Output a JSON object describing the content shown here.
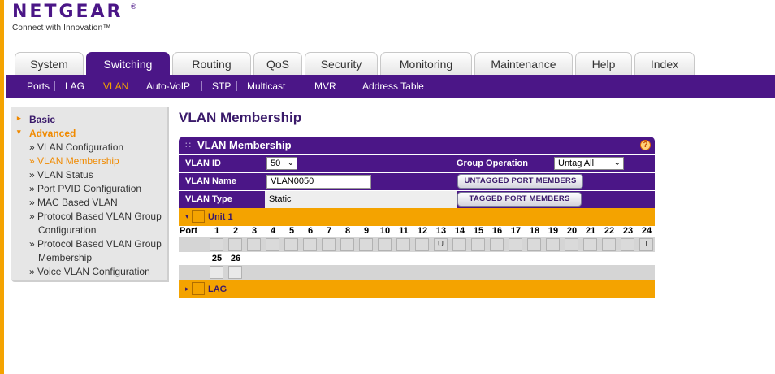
{
  "brand": {
    "name": "NETGEAR",
    "tm": "®",
    "tagline": "Connect with Innovation™"
  },
  "tabs": [
    {
      "label": "System",
      "active": false
    },
    {
      "label": "Switching",
      "active": true
    },
    {
      "label": "Routing",
      "active": false
    },
    {
      "label": "QoS",
      "active": false
    },
    {
      "label": "Security",
      "active": false
    },
    {
      "label": "Monitoring",
      "active": false
    },
    {
      "label": "Maintenance",
      "active": false
    },
    {
      "label": "Help",
      "active": false
    },
    {
      "label": "Index",
      "active": false
    }
  ],
  "subnav": [
    {
      "label": "Ports",
      "active": false
    },
    {
      "label": "LAG",
      "active": false
    },
    {
      "label": "VLAN",
      "active": true
    },
    {
      "label": "Auto-VoIP",
      "active": false
    },
    {
      "label": "STP",
      "active": false
    },
    {
      "label": "Multicast",
      "active": false
    },
    {
      "label": "MVR",
      "active": false
    },
    {
      "label": "Address Table",
      "active": false
    }
  ],
  "sidebar": {
    "basic": "Basic",
    "advanced": "Advanced",
    "items": [
      {
        "label": "» VLAN Configuration",
        "active": false
      },
      {
        "label": "» VLAN Membership",
        "active": true
      },
      {
        "label": "» VLAN Status",
        "active": false
      },
      {
        "label": "» Port PVID Configuration",
        "active": false
      },
      {
        "label": "» MAC Based VLAN",
        "active": false
      },
      {
        "label": "» Protocol Based VLAN Group",
        "active": false
      },
      {
        "label": "Configuration",
        "active": false
      },
      {
        "label": "» Protocol Based VLAN Group",
        "active": false
      },
      {
        "label": "Membership",
        "active": false
      },
      {
        "label": "» Voice VLAN Configuration",
        "active": false
      }
    ]
  },
  "main": {
    "page_title": "VLAN Membership",
    "panel_title": "VLAN Membership",
    "help": "?",
    "vlan_id_label": "VLAN ID",
    "vlan_id_value": "50",
    "group_operation_label": "Group Operation",
    "group_operation_value": "Untag All",
    "vlan_name_label": "VLAN Name",
    "vlan_name_value": "VLAN0050",
    "untagged_button": "UNTAGGED PORT MEMBERS",
    "vlan_type_label": "VLAN Type",
    "vlan_type_value": "Static",
    "tagged_button": "TAGGED PORT MEMBERS",
    "unit_label": "Unit 1",
    "port_label": "Port",
    "ports_row1": [
      "1",
      "2",
      "3",
      "4",
      "5",
      "6",
      "7",
      "8",
      "9",
      "10",
      "11",
      "12",
      "13",
      "14",
      "15",
      "16",
      "17",
      "18",
      "19",
      "20",
      "21",
      "22",
      "23",
      "24"
    ],
    "ports_row1_values": [
      "",
      "",
      "",
      "",
      "",
      "",
      "",
      "",
      "",
      "",
      "",
      "",
      "U",
      "",
      "",
      "",
      "",
      "",
      "",
      "",
      "",
      "",
      "",
      "T"
    ],
    "ports_row2": [
      "25",
      "26"
    ],
    "ports_row2_values": [
      "",
      ""
    ],
    "lag_label": "LAG"
  },
  "colors": {
    "brand_purple": "#4b1687",
    "accent_orange": "#f4a300"
  }
}
